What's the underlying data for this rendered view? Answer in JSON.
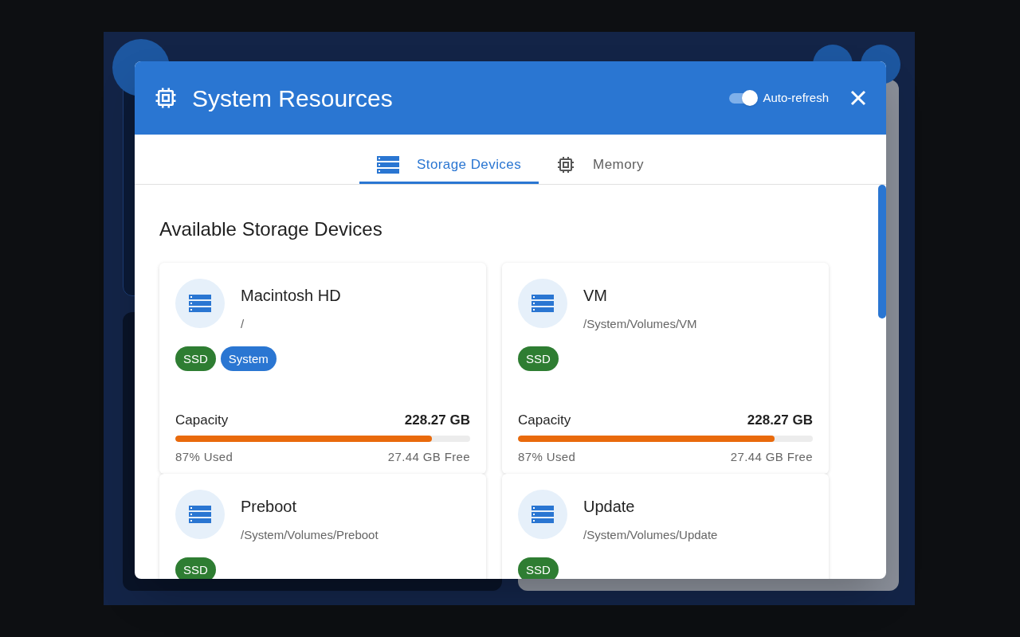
{
  "dialog": {
    "title": "System Resources",
    "auto_refresh": {
      "label": "Auto-refresh",
      "on": true
    }
  },
  "tabs": [
    {
      "label": "Storage Devices",
      "kind": "storage",
      "selected": true
    },
    {
      "label": "Memory",
      "kind": "chip",
      "selected": false
    }
  ],
  "section_title": "Available Storage Devices",
  "devices": [
    {
      "name": "Macintosh HD",
      "path": "/",
      "tags": [
        {
          "label": "SSD",
          "color": "#2e7d32"
        },
        {
          "label": "System",
          "color": "#2a76d2"
        }
      ],
      "capacity_label": "Capacity",
      "capacity": "228.27 GB",
      "level": 0.87,
      "used": "87% Used",
      "free": "27.44 GB Free"
    },
    {
      "name": "VM",
      "path": "/System/Volumes/VM",
      "tags": [
        {
          "label": "SSD",
          "color": "#2e7d32"
        }
      ],
      "capacity_label": "Capacity",
      "capacity": "228.27 GB",
      "level": 0.87,
      "used": "87% Used",
      "free": "27.44 GB Free"
    },
    {
      "name": "Preboot",
      "path": "/System/Volumes/Preboot",
      "tags": [
        {
          "label": "SSD",
          "color": "#2e7d32"
        }
      ]
    },
    {
      "name": "Update",
      "path": "/System/Volumes/Update",
      "tags": [
        {
          "label": "SSD",
          "color": "#2e7d32"
        }
      ]
    }
  ]
}
